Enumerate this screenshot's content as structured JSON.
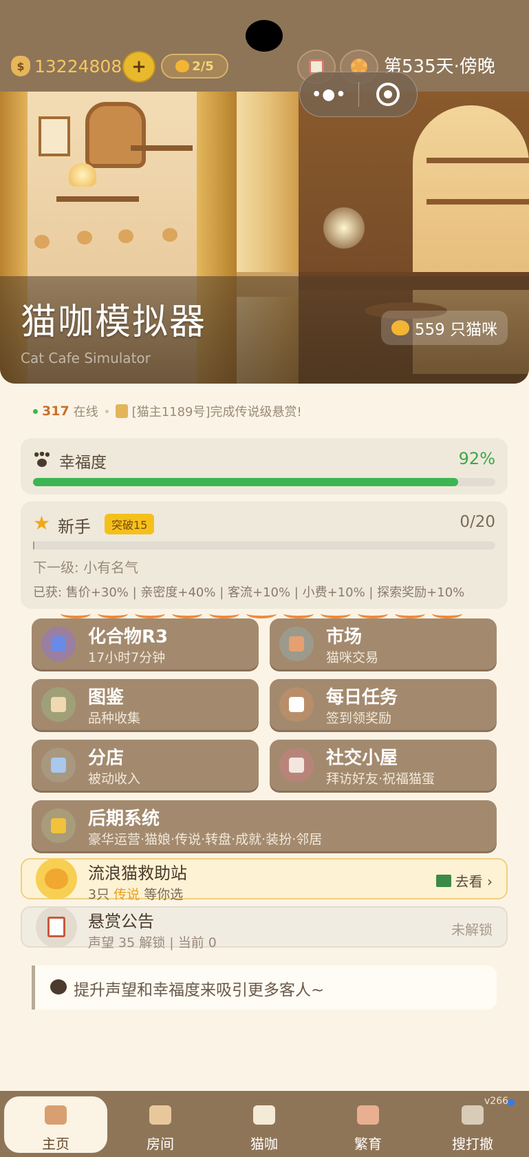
{
  "status": {
    "money": "13224808",
    "cat_slots": "2/5",
    "day_label": "第535天·傍晚",
    "capsule_dots": "•●•"
  },
  "hero": {
    "title": "猫咖模拟器",
    "subtitle": "Cat Cafe Simulator",
    "cat_count": "559 只猫咪"
  },
  "ticker": {
    "online_count": "317",
    "online_label": "在线",
    "message": "[猫主1189号]完成传说级悬赏!"
  },
  "happiness": {
    "label": "幸福度",
    "percent_text": "92%",
    "value": 0.92
  },
  "level": {
    "name": "新手",
    "badge": "突破15",
    "progress_text": "0/20",
    "progress": 0.0,
    "next_level": "下一级: 小有名气",
    "perks": "已获: 售价+30% | 亲密度+40% | 客流+10% | 小费+10% | 探索奖励+10%"
  },
  "features": [
    {
      "title": "化合物R3",
      "sub": "17小时7分钟",
      "icon": "dna-icon",
      "icon_bg": "#9a7fa0",
      "icon_color": "#6a8ae8"
    },
    {
      "title": "市场",
      "sub": "猫咪交易",
      "icon": "shopping-bag-icon",
      "icon_bg": "#9c9a8c",
      "icon_color": "#e6a070"
    },
    {
      "title": "图鉴",
      "sub": "品种收集",
      "icon": "book-icon",
      "icon_bg": "#a0a078",
      "icon_color": "#f0d8b0"
    },
    {
      "title": "每日任务",
      "sub": "签到领奖励",
      "icon": "clipboard-icon",
      "icon_bg": "#b88e6a",
      "icon_color": "#ffffff"
    },
    {
      "title": "分店",
      "sub": "被动收入",
      "icon": "building-icon",
      "icon_bg": "#a89880",
      "icon_color": "#a8c8ec"
    },
    {
      "title": "社交小屋",
      "sub": "拜访好友·祝福猫蛋",
      "icon": "house-icon",
      "icon_bg": "#b8847a",
      "icon_color": "#f2e6de"
    },
    {
      "title": "后期系统",
      "sub": "豪华运营·猫娘·传说·转盘·成就·装扮·邻居",
      "icon": "crown-icon",
      "icon_bg": "#a89c7a",
      "icon_color": "#f2c23c"
    }
  ],
  "rescue": {
    "title": "流浪猫救助站",
    "sub_prefix": "3只",
    "sub_highlight": "传说",
    "sub_suffix": "等你选",
    "action": "去看 ›"
  },
  "bounty": {
    "title": "悬赏公告",
    "sub": "声望 35 解锁 | 当前 0",
    "status": "未解锁"
  },
  "hint": {
    "text": "提升声望和幸福度来吸引更多客人~"
  },
  "nav": {
    "items": [
      {
        "label": "主页",
        "icon": "home-icon",
        "color": "#d8a070"
      },
      {
        "label": "房间",
        "icon": "cafe-cup-icon",
        "color": "#e8c89a"
      },
      {
        "label": "猫咖",
        "icon": "cat-face-icon",
        "color": "#f4ead8"
      },
      {
        "label": "繁育",
        "icon": "cat-couple-icon",
        "color": "#e8b090"
      },
      {
        "label": "搜打撤",
        "icon": "magnifier-icon",
        "color": "#d8ccb8"
      }
    ],
    "version": "v266"
  },
  "colors": {
    "accent_gold": "#f6c760",
    "happiness_green": "#3cb553",
    "tile_brown": "#a38a6e",
    "nav_brown": "#8f7558"
  }
}
